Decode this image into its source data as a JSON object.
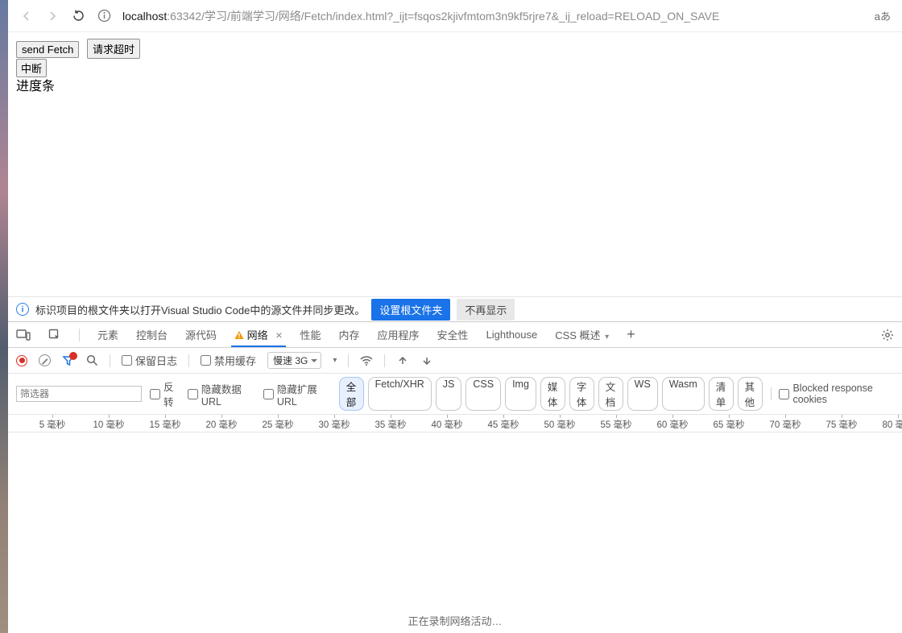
{
  "browser": {
    "host": "localhost",
    "url_rest": ":63342/学习/前端学习/网络/Fetch/index.html?_ijt=fsqos2kjivfmtom3n9kf5rjre7&_ij_reload=RELOAD_ON_SAVE",
    "aa": "aあ"
  },
  "page": {
    "btn_send": "send Fetch",
    "btn_timeout": "请求超时",
    "btn_abort": "中断",
    "progress_label": "进度条"
  },
  "infobar": {
    "text": "标识项目的根文件夹以打开Visual Studio Code中的源文件并同步更改。",
    "set_root": "设置根文件夹",
    "dismiss": "不再显示"
  },
  "devtools_tabs": {
    "elements": "元素",
    "console": "控制台",
    "sources": "源代码",
    "network": "网络",
    "performance": "性能",
    "memory": "内存",
    "application": "应用程序",
    "security": "安全性",
    "lighthouse": "Lighthouse",
    "cssoverview": "CSS 概述"
  },
  "net_toolbar": {
    "preserve_log": "保留日志",
    "disable_cache": "禁用缓存",
    "throttle": "慢速 3G"
  },
  "filters": {
    "placeholder": "筛选器",
    "invert": "反转",
    "hide_data": "隐藏数据 URL",
    "hide_ext": "隐藏扩展 URL",
    "blocked_cookies": "Blocked response cookies",
    "chips": [
      "全部",
      "Fetch/XHR",
      "JS",
      "CSS",
      "Img",
      "媒体",
      "字体",
      "文档",
      "WS",
      "Wasm",
      "清单",
      "其他"
    ]
  },
  "ruler": {
    "unit": "毫秒",
    "marks": [
      5,
      10,
      15,
      20,
      25,
      30,
      35,
      40,
      45,
      50,
      55,
      60,
      65,
      70,
      75,
      80
    ]
  },
  "recording_msg": "正在录制网络活动…"
}
